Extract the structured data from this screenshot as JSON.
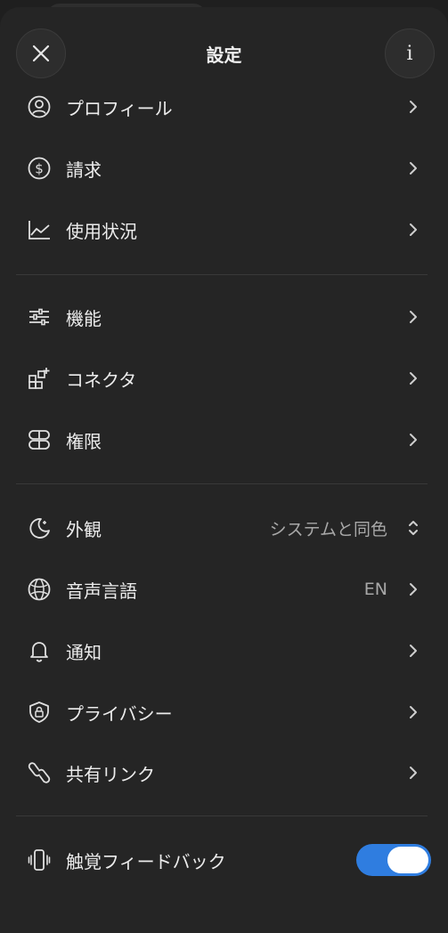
{
  "header": {
    "title": "設定"
  },
  "groups": [
    {
      "items": [
        {
          "label": "プロフィール",
          "icon": "profile-icon"
        },
        {
          "label": "請求",
          "icon": "dollar-icon"
        },
        {
          "label": "使用状況",
          "icon": "chart-icon"
        }
      ]
    },
    {
      "items": [
        {
          "label": "機能",
          "icon": "sliders-icon"
        },
        {
          "label": "コネクタ",
          "icon": "connector-icon"
        },
        {
          "label": "権限",
          "icon": "permissions-icon"
        }
      ]
    },
    {
      "items": [
        {
          "label": "外観",
          "icon": "moon-icon",
          "value": "システムと同色"
        },
        {
          "label": "音声言語",
          "icon": "globe-icon",
          "value": "EN"
        },
        {
          "label": "通知",
          "icon": "bell-icon"
        },
        {
          "label": "プライバシー",
          "icon": "shield-lock-icon"
        },
        {
          "label": "共有リンク",
          "icon": "link-icon"
        }
      ]
    },
    {
      "items": [
        {
          "label": "触覚フィードバック",
          "icon": "haptic-icon",
          "toggle": true
        }
      ]
    }
  ],
  "colors": {
    "accent": "#2f7de0",
    "background": "#252525"
  }
}
